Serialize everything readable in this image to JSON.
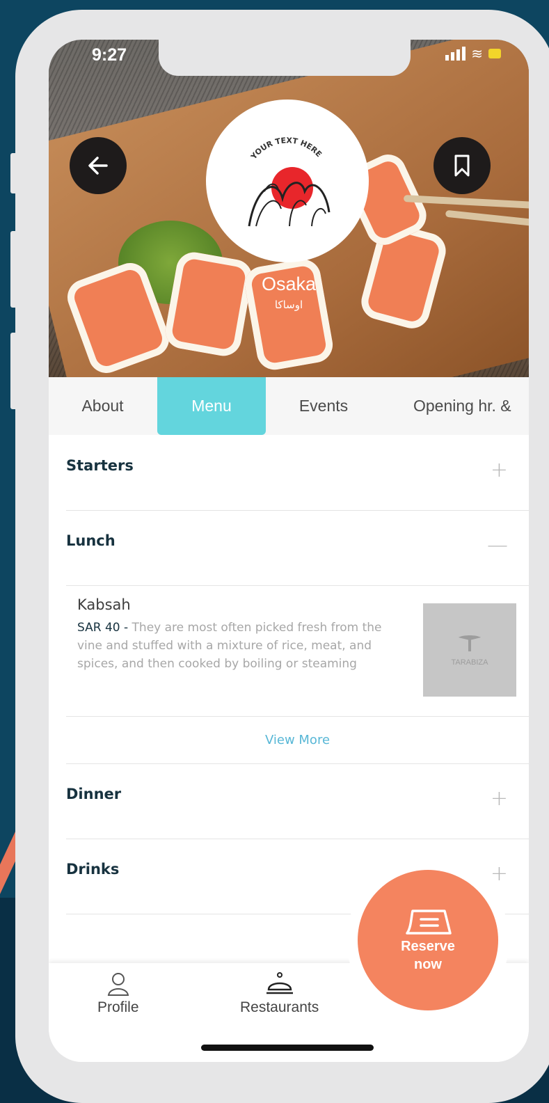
{
  "status_bar": {
    "time": "9:27"
  },
  "restaurant": {
    "name": "Osaka",
    "name_ar": "اوساكا",
    "logo_text": "YOUR TEXT HERE"
  },
  "tabs": [
    {
      "label": "About",
      "active": false
    },
    {
      "label": "Menu",
      "active": true
    },
    {
      "label": "Events",
      "active": false
    },
    {
      "label": "Opening hr. &",
      "active": false
    }
  ],
  "menu": {
    "sections": [
      {
        "title": "Starters",
        "toggle": "+"
      },
      {
        "title": "Lunch",
        "toggle": "—"
      },
      {
        "title": "Dinner",
        "toggle": "+"
      },
      {
        "title": "Drinks",
        "toggle": "+"
      }
    ],
    "items": [
      {
        "name": "Kabsah",
        "price": "SAR 40 -",
        "description": "They are most often picked fresh from the vine and stuffed with a mixture of rice, meat, and spices, and then cooked by boiling or steaming",
        "image_text": "TARABIZA"
      }
    ],
    "view_more": "View More"
  },
  "reserve": {
    "line1": "Reserve",
    "line2": "now"
  },
  "bottom_nav": [
    {
      "label": "Profile",
      "icon": "user-icon"
    },
    {
      "label": "Restaurants",
      "icon": "cloche-icon"
    }
  ],
  "colors": {
    "accent_tab": "#63d5dd",
    "reserve": "#f4845f",
    "heading": "#17323f",
    "link": "#58b7d6",
    "background": "#0d4560"
  }
}
